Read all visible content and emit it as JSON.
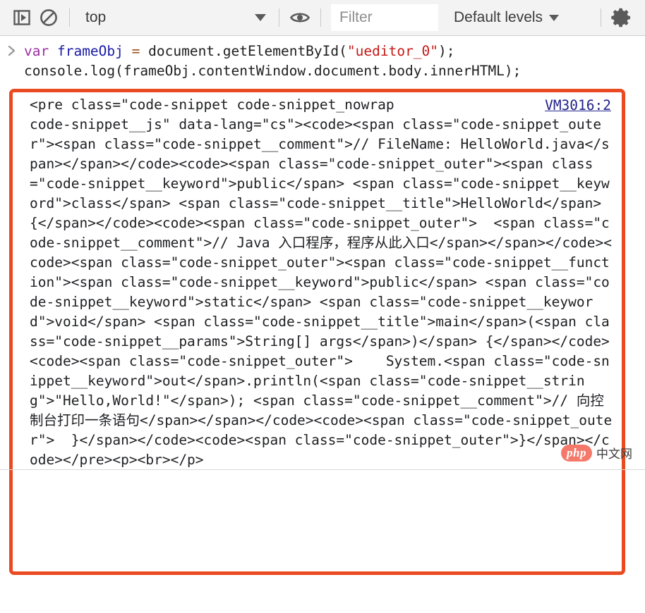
{
  "toolbar": {
    "sidebar_toggle_icon": "console-sidebar-icon",
    "clear_console_icon": "clear-console-no-entry-icon",
    "context_value": "top",
    "context_caret_icon": "chevron-down-icon",
    "eye_icon": "live-expression-eye-icon",
    "filter_placeholder": "Filter",
    "filter_value": "",
    "levels_label": "Default levels",
    "levels_caret_icon": "chevron-down-icon",
    "settings_icon": "gear-icon"
  },
  "console": {
    "prompt_icon": "prompt-chevron-right-icon",
    "input_segments": [
      {
        "text": "var ",
        "cls": "kw"
      },
      {
        "text": "frameObj ",
        "cls": "ident"
      },
      {
        "text": "= ",
        "cls": "op"
      },
      {
        "text": "document.getElementById(",
        "cls": ""
      },
      {
        "text": "\"ueditor_0\"",
        "cls": "str"
      },
      {
        "text": ");\nconsole.log(frameObj.contentWindow.document.body.innerHTML);",
        "cls": ""
      }
    ],
    "input_plain": "var frameObj = document.getElementById(\"ueditor_0\");\nconsole.log(frameObj.contentWindow.document.body.innerHTML);"
  },
  "output": {
    "source_link": "VM3016:2",
    "head_text": "<pre class=\"code-snippet code-snippet_nowrap ",
    "body_text": "code-snippet__js\" data-lang=\"cs\"><code><span class=\"code-snippet_outer\"><span class=\"code-snippet__comment\">// FileName: HelloWorld.java</span></span></code><code><span class=\"code-snippet_outer\"><span class=\"code-snippet__keyword\">public</span> <span class=\"code-snippet__keyword\">class</span> <span class=\"code-snippet__title\">HelloWorld</span> {</span></code><code><span class=\"code-snippet_outer\">  <span class=\"code-snippet__comment\">// Java 入口程序，程序从此入口</span></span></code><code><span class=\"code-snippet_outer\"><span class=\"code-snippet__function\"><span class=\"code-snippet__keyword\">public</span> <span class=\"code-snippet__keyword\">static</span> <span class=\"code-snippet__keyword\">void</span> <span class=\"code-snippet__title\">main</span>(<span class=\"code-snippet__params\">String[] args</span>)</span> {</span></code><code><span class=\"code-snippet_outer\">    System.<span class=\"code-snippet__keyword\">out</span>.println(<span class=\"code-snippet__string\">\"Hello,World!\"</span>); <span class=\"code-snippet__comment\">// 向控制台打印一条语句</span></span></code><code><span class=\"code-snippet_outer\">  }</span></code><code><span class=\"code-snippet_outer\">}</span></code></pre><p><br></p>"
  },
  "watermark": {
    "logo_text": "php",
    "site_text": "中文网"
  }
}
